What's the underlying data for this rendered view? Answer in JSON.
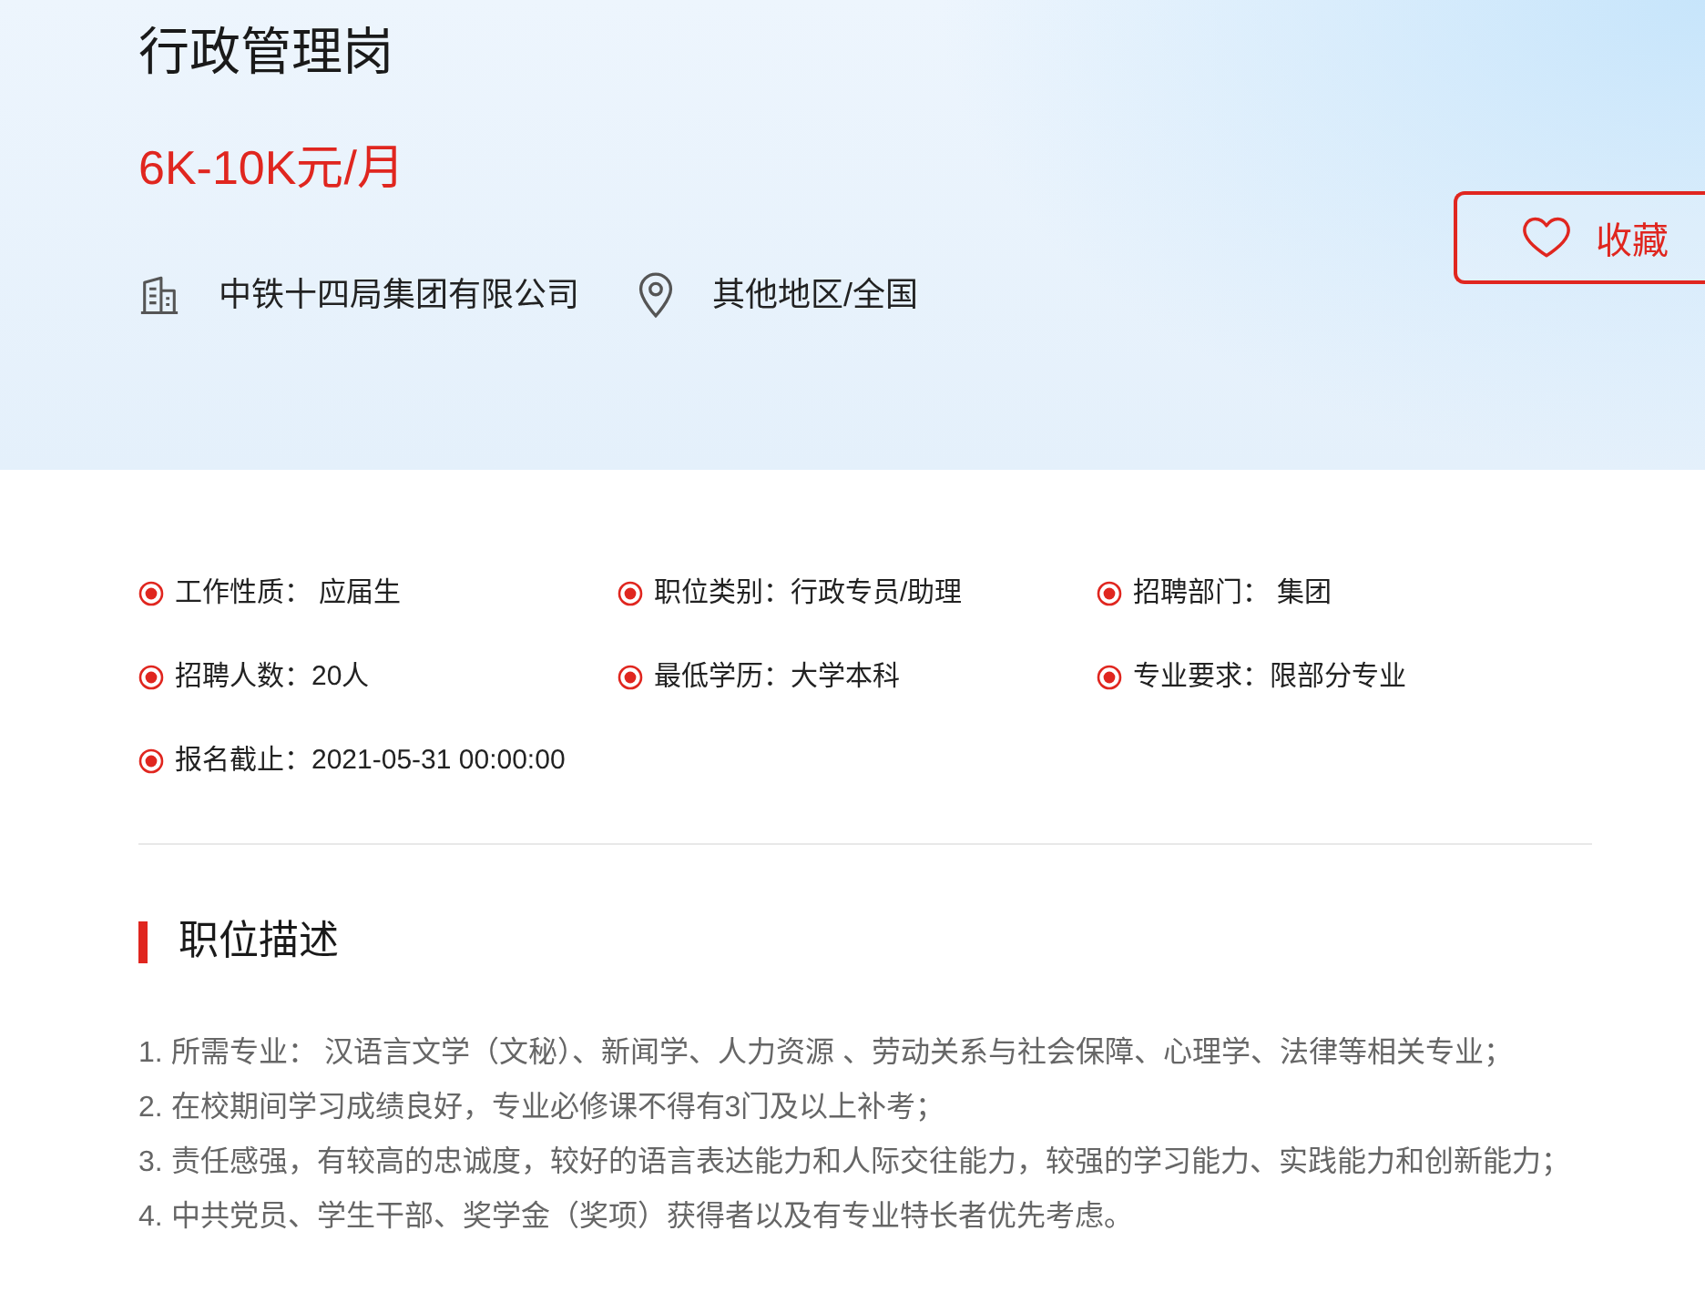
{
  "job": {
    "title": "行政管理岗",
    "salary": "6K-10K元/月",
    "company": "中铁十四局集团有限公司",
    "location": "其他地区/全国"
  },
  "favorite_button": {
    "label": "收藏",
    "favorited": false
  },
  "attributes": [
    {
      "text": "工作性质： 应届生"
    },
    {
      "text": "职位类别：行政专员/助理"
    },
    {
      "text": "招聘部门： 集团"
    },
    {
      "text": "招聘人数：20人"
    },
    {
      "text": "最低学历：大学本科"
    },
    {
      "text": "专业要求：限部分专业"
    },
    {
      "text": "报名截止：2021-05-31 00:00:00"
    }
  ],
  "description": {
    "title": "职位描述",
    "lines": [
      "1. 所需专业： 汉语言文学（文秘）、新闻学、人力资源 、劳动关系与社会保障、心理学、法律等相关专业；",
      "2. 在校期间学习成绩良好，专业必修课不得有3门及以上补考；",
      "3. 责任感强，有较高的忠诚度，较好的语言表达能力和人际交往能力，较强的学习能力、实践能力和创新能力；",
      "4. 中共党员、学生干部、奖学金（奖项）获得者以及有专业特长者优先考虑。"
    ]
  }
}
